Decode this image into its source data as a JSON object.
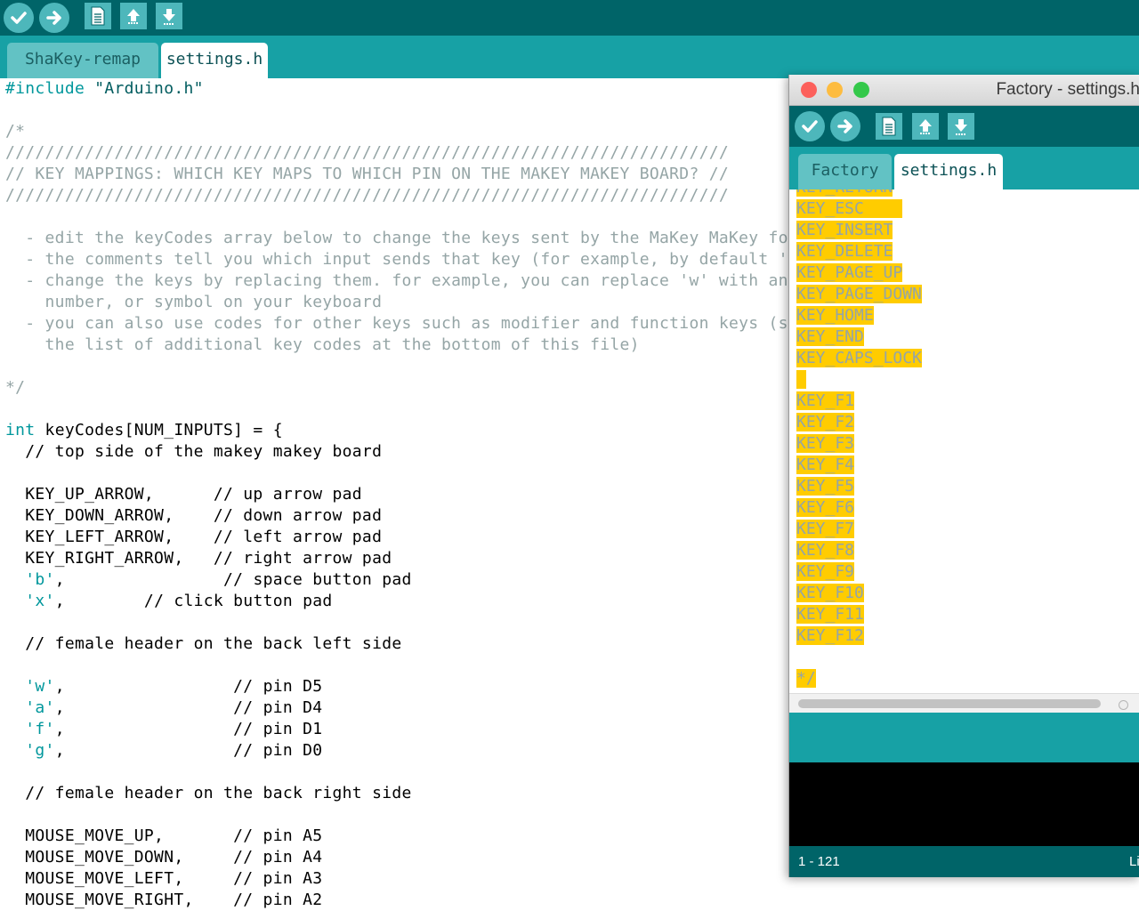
{
  "main": {
    "toolbar": {
      "buttons": [
        {
          "name": "verify",
          "icon": "checkmark-icon"
        },
        {
          "name": "upload",
          "icon": "arrow-right-icon"
        },
        {
          "name": "new",
          "icon": "document-icon"
        },
        {
          "name": "open",
          "icon": "arrow-up-icon"
        },
        {
          "name": "save",
          "icon": "arrow-down-icon"
        }
      ]
    },
    "tabs": [
      {
        "label": "ShaKey-remap",
        "active": false
      },
      {
        "label": "settings.h",
        "active": true
      }
    ],
    "code_lines": [
      {
        "segments": [
          {
            "t": "#include ",
            "k": "kw"
          },
          {
            "t": "\"Arduino.h\"",
            "k": "str"
          }
        ]
      },
      {
        "segments": []
      },
      {
        "segments": [
          {
            "t": "/*",
            "k": "comment"
          }
        ]
      },
      {
        "segments": [
          {
            "t": "/////////////////////////////////////////////////////////////////////////",
            "k": "comment"
          }
        ]
      },
      {
        "segments": [
          {
            "t": "// KEY MAPPINGS: WHICH KEY MAPS TO WHICH PIN ON THE MAKEY MAKEY BOARD? //",
            "k": "comment"
          }
        ]
      },
      {
        "segments": [
          {
            "t": "/////////////////////////////////////////////////////////////////////////",
            "k": "comment"
          }
        ]
      },
      {
        "segments": []
      },
      {
        "segments": [
          {
            "t": "  - edit the keyCodes array below to change the keys sent by the MaKey MaKey for eac",
            "k": "comment"
          }
        ]
      },
      {
        "segments": [
          {
            "t": "  - the comments tell you which input sends that key (for example, by default 'w' is",
            "k": "comment"
          }
        ]
      },
      {
        "segments": [
          {
            "t": "  - change the keys by replacing them. for example, you can replace 'w' with any oth",
            "k": "comment"
          }
        ]
      },
      {
        "segments": [
          {
            "t": "    number, or symbol on your keyboard",
            "k": "comment"
          }
        ]
      },
      {
        "segments": [
          {
            "t": "  - you can also use codes for other keys such as modifier and function keys (see th",
            "k": "comment"
          }
        ]
      },
      {
        "segments": [
          {
            "t": "    the list of additional key codes at the bottom of this file)",
            "k": "comment"
          }
        ]
      },
      {
        "segments": []
      },
      {
        "segments": [
          {
            "t": "*/",
            "k": "comment"
          }
        ]
      },
      {
        "segments": []
      },
      {
        "segments": [
          {
            "t": "int",
            "k": "kw"
          },
          {
            "t": " keyCodes[NUM_INPUTS] = {",
            "k": "code"
          }
        ]
      },
      {
        "segments": [
          {
            "t": "  // top side of the makey makey board",
            "k": "code"
          }
        ]
      },
      {
        "segments": []
      },
      {
        "segments": [
          {
            "t": "  KEY_UP_ARROW,      // up arrow pad",
            "k": "code"
          }
        ]
      },
      {
        "segments": [
          {
            "t": "  KEY_DOWN_ARROW,    // down arrow pad",
            "k": "code"
          }
        ]
      },
      {
        "segments": [
          {
            "t": "  KEY_LEFT_ARROW,    // left arrow pad",
            "k": "code"
          }
        ]
      },
      {
        "segments": [
          {
            "t": "  KEY_RIGHT_ARROW,   // right arrow pad",
            "k": "code"
          }
        ]
      },
      {
        "segments": [
          {
            "t": "  ",
            "k": "code"
          },
          {
            "t": "'b'",
            "k": "char"
          },
          {
            "t": ",                // space button pad",
            "k": "code"
          }
        ]
      },
      {
        "segments": [
          {
            "t": "  ",
            "k": "code"
          },
          {
            "t": "'x'",
            "k": "char"
          },
          {
            "t": ",        // click button pad",
            "k": "code"
          }
        ]
      },
      {
        "segments": []
      },
      {
        "segments": [
          {
            "t": "  // female header on the back left side",
            "k": "code"
          }
        ]
      },
      {
        "segments": []
      },
      {
        "segments": [
          {
            "t": "  ",
            "k": "code"
          },
          {
            "t": "'w'",
            "k": "char"
          },
          {
            "t": ",                 // pin D5",
            "k": "code"
          }
        ]
      },
      {
        "segments": [
          {
            "t": "  ",
            "k": "code"
          },
          {
            "t": "'a'",
            "k": "char"
          },
          {
            "t": ",                 // pin D4",
            "k": "code"
          }
        ]
      },
      {
        "segments": [
          {
            "t": "  ",
            "k": "code"
          },
          {
            "t": "'f'",
            "k": "char"
          },
          {
            "t": ",                 // pin D1",
            "k": "code"
          }
        ]
      },
      {
        "segments": [
          {
            "t": "  ",
            "k": "code"
          },
          {
            "t": "'g'",
            "k": "char"
          },
          {
            "t": ",                 // pin D0",
            "k": "code"
          }
        ]
      },
      {
        "segments": []
      },
      {
        "segments": [
          {
            "t": "  // female header on the back right side",
            "k": "code"
          }
        ]
      },
      {
        "segments": []
      },
      {
        "segments": [
          {
            "t": "  MOUSE_MOVE_UP,       // pin A5",
            "k": "code"
          }
        ]
      },
      {
        "segments": [
          {
            "t": "  MOUSE_MOVE_DOWN,     // pin A4",
            "k": "code"
          }
        ]
      },
      {
        "segments": [
          {
            "t": "  MOUSE_MOVE_LEFT,     // pin A3",
            "k": "code"
          }
        ]
      },
      {
        "segments": [
          {
            "t": "  MOUSE_MOVE_RIGHT,    // pin A2",
            "k": "code"
          }
        ]
      }
    ]
  },
  "factory": {
    "title": "Factory - settings.h",
    "traffic_lights": {
      "close": "#fc605b",
      "minimize": "#fdbc40",
      "zoom": "#34c84a"
    },
    "tabs": [
      {
        "label": "Factory",
        "active": false
      },
      {
        "label": "settings.h",
        "active": true
      }
    ],
    "highlight_color": "#ffcc00",
    "lines": [
      "KEY_RETURN",
      "KEY_ESC    ",
      "KEY_INSERT",
      "KEY_DELETE",
      "KEY_PAGE_UP",
      "KEY_PAGE_DOWN",
      "KEY_HOME",
      "KEY_END",
      "KEY_CAPS_LOCK",
      " ",
      "KEY_F1",
      "KEY_F2",
      "KEY_F3",
      "KEY_F4",
      "KEY_F5",
      "KEY_F6",
      "KEY_F7",
      "KEY_F8",
      "KEY_F9",
      "KEY_F10",
      "KEY_F11",
      "KEY_F12",
      "",
      "*/"
    ],
    "status_line": "1 - 121",
    "board_text": "Li"
  }
}
